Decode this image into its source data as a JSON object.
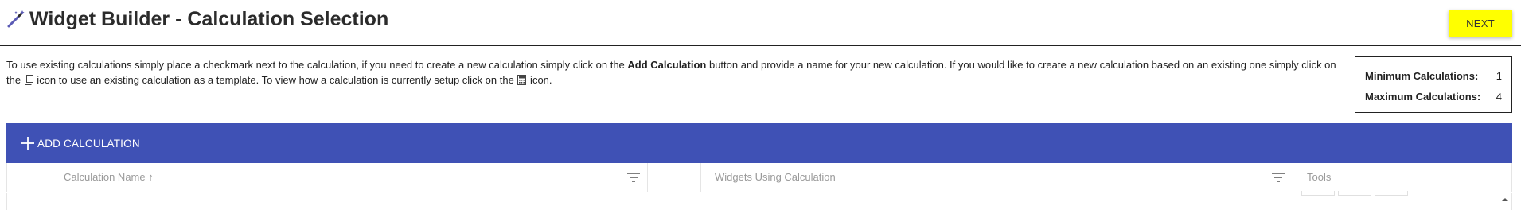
{
  "header": {
    "title": "Widget Builder - Calculation Selection",
    "next_label": "NEXT",
    "next_color": "#ffff00"
  },
  "instructions": {
    "part1": "To use existing calculations simply place a checkmark next to the calculation, if you need to create a new calculation simply click on the ",
    "bold": "Add Calculation",
    "part2": " button and provide a name for your new calculation. If you would like to create a new calculation based on an existing one simply click on the ",
    "part3": " icon to use an existing calculation as a template. To view how a calculation is currently setup click on the ",
    "part4": " icon.",
    "copy_icon": "copy-icon",
    "calculator_icon": "calculator-icon"
  },
  "limits": {
    "min_label": "Minimum Calculations:",
    "min_value": "1",
    "max_label": "Maximum Calculations:",
    "max_value": "4"
  },
  "toolbar": {
    "add_label": "ADD CALCULATION",
    "accent": "#3f51b5"
  },
  "grid": {
    "columns": [
      {
        "label": "",
        "sort": ""
      },
      {
        "label": "Calculation Name",
        "sort": "↑"
      },
      {
        "label": ""
      },
      {
        "label": "Widgets Using Calculation"
      },
      {
        "label": "Tools"
      }
    ]
  }
}
